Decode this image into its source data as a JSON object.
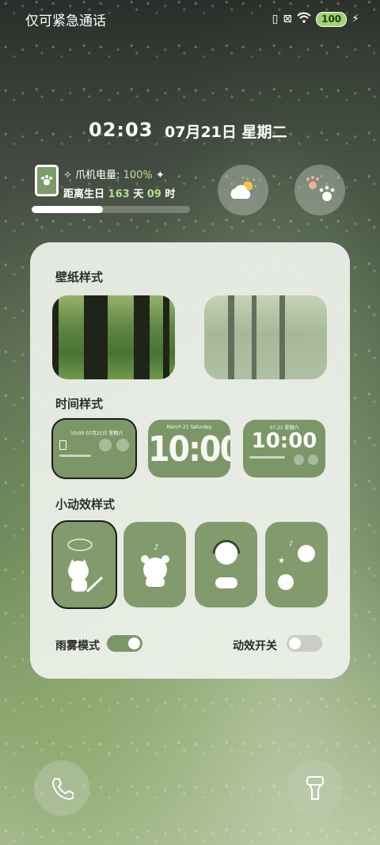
{
  "status_bar": {
    "carrier_text": "仅可紧急通话",
    "battery": "100"
  },
  "lock": {
    "time": "02:03",
    "date": "07月21日 星期二"
  },
  "widget": {
    "battery_label": "爪机电量:",
    "battery_value": "100%",
    "birthday_label": "距离生日",
    "days_value": "163",
    "days_unit": "天",
    "hours_value": "09",
    "hours_unit": "时",
    "progress_fraction": 0.45
  },
  "panel": {
    "wallpaper_title": "壁纸样式",
    "time_style_title": "时间样式",
    "anim_title": "小动效样式",
    "time_style_2": {
      "line1": "March 21   Saturday",
      "big": "10:00"
    },
    "time_style_3": {
      "big": "10:00",
      "date": "07.21   星期六"
    },
    "time_style_1": {
      "time": "10:00",
      "date": "07月21日 星期六"
    },
    "rain_label": "雨雾模式",
    "rain_on": true,
    "anim_switch_label": "动效开关",
    "anim_switch_on": false
  },
  "colors": {
    "accent": "#7d9667",
    "panel_bg": "#eef2ec"
  },
  "icons": [
    "weather-icon",
    "paw-icon",
    "phone-icon",
    "flashlight-icon"
  ]
}
